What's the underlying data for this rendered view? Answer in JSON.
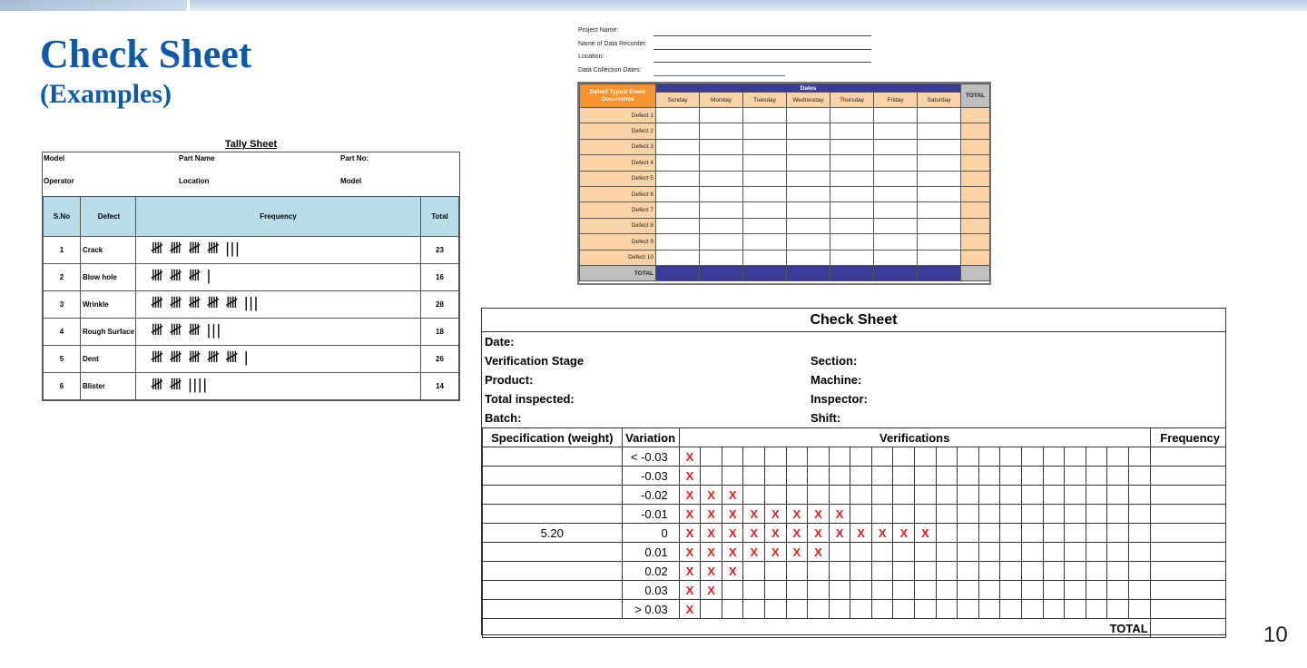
{
  "slide": {
    "title": "Check Sheet",
    "subtitle": "(Examples)",
    "page_number": "10"
  },
  "tally_sheet": {
    "title": "Tally Sheet",
    "meta": {
      "model": "Model",
      "part_name": "Part Name",
      "part_no": "Part No:",
      "operator": "Operator",
      "location": "Location",
      "model2": "Model"
    },
    "headers": [
      "S.No",
      "Defect",
      "Frequency",
      "Total"
    ],
    "rows": [
      {
        "sno": "1",
        "defect": "Crack",
        "tally": "𝍸 𝍸 𝍸 𝍸 |||",
        "total": "23"
      },
      {
        "sno": "2",
        "defect": "Blow hole",
        "tally": "𝍸 𝍸 𝍸 |",
        "total": "16"
      },
      {
        "sno": "3",
        "defect": "Wrinkle",
        "tally": "𝍸 𝍸 𝍸 𝍸 𝍸 |||",
        "total": "28"
      },
      {
        "sno": "4",
        "defect": "Rough Surface",
        "tally": "𝍸 𝍸 𝍸 |||",
        "total": "18"
      },
      {
        "sno": "5",
        "defect": "Dent",
        "tally": "𝍸 𝍸 𝍸 𝍸 𝍸 |",
        "total": "26"
      },
      {
        "sno": "6",
        "defect": "Blister",
        "tally": "𝍸 𝍸 ||||",
        "total": "14"
      }
    ]
  },
  "weekly_sheet": {
    "fields": [
      "Project Name:",
      "Name of Data Recorder:",
      "Location:",
      "Data Collection Dates:"
    ],
    "corner_label": "Defect Types/ Event Occurrence",
    "dates_label": "Dates",
    "days": [
      "Sunday",
      "Monday",
      "Tuesday",
      "Wednesday",
      "Thursday",
      "Friday",
      "Saturday"
    ],
    "total_label": "TOTAL",
    "rows": [
      "Defect 1",
      "Defect 2",
      "Defect 3",
      "Defect 4",
      "Defect 5",
      "Defect 6",
      "Defect 7",
      "Defect 8",
      "Defect 9",
      "Defect 10"
    ],
    "footer_label": "TOTAL"
  },
  "check_sheet": {
    "title": "Check Sheet",
    "info": {
      "date": "Date:",
      "verification_stage": "Verification Stage",
      "section": "Section:",
      "product": "Product:",
      "machine": "Machine:",
      "total_inspected": "Total inspected:",
      "inspector": "Inspector:",
      "batch": "Batch:",
      "shift": "Shift:"
    },
    "headers": {
      "spec": "Specification (weight)",
      "variation": "Variation",
      "verifications": "Verifications",
      "frequency": "Frequency"
    },
    "spec_value": "5.20",
    "rows": [
      {
        "variation": "< -0.03",
        "marks": 1
      },
      {
        "variation": "-0.03",
        "marks": 1
      },
      {
        "variation": "-0.02",
        "marks": 3
      },
      {
        "variation": "-0.01",
        "marks": 8
      },
      {
        "variation": "0",
        "marks": 12
      },
      {
        "variation": "0.01",
        "marks": 7
      },
      {
        "variation": "0.02",
        "marks": 3
      },
      {
        "variation": "0.03",
        "marks": 2
      },
      {
        "variation": "> 0.03",
        "marks": 1
      }
    ],
    "mark_symbol": "X",
    "total_label": "TOTAL"
  }
}
